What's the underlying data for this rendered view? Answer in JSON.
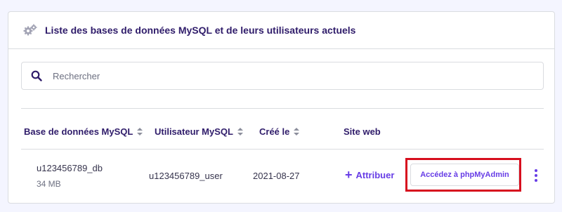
{
  "card": {
    "title": "Liste des bases de données MySQL et de leurs utilisateurs actuels",
    "title_icon": "gears-icon"
  },
  "search": {
    "placeholder": "Rechercher",
    "value": "",
    "icon": "search-icon"
  },
  "table": {
    "columns": [
      {
        "label": "Base de données MySQL",
        "sortable": true
      },
      {
        "label": "Utilisateur MySQL",
        "sortable": true
      },
      {
        "label": "Créé le",
        "sortable": true
      },
      {
        "label": "Site web",
        "sortable": false
      }
    ],
    "rows": [
      {
        "database": "u123456789_db",
        "size": "34 MB",
        "user": "u123456789_user",
        "created": "2021-08-27",
        "assign_label": "Attribuer",
        "phpmyadmin_label": "Accédez à phpMyAdmin"
      }
    ]
  },
  "colors": {
    "accent": "#673de6",
    "highlight": "#d70f1e",
    "heading": "#2f1c6a",
    "border": "#dadce0",
    "background": "#f4f5ff"
  }
}
